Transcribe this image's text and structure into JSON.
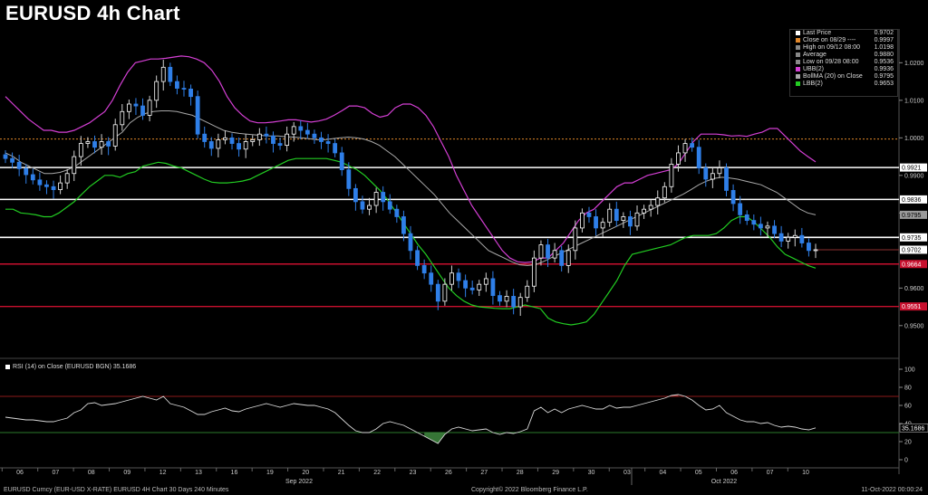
{
  "title": "EURUSD 4h Chart",
  "footer": {
    "left": "EURUSD Curncy (EUR-USD X-RATE) EURUSD 4H Chart 30 Days 240 Minutes",
    "center": "Copyright© 2022 Bloomberg Finance L.P.",
    "right": "11-Oct-2022 00:00:24"
  },
  "colors": {
    "up_candle": "#ffffff",
    "down_candle": "#2f7fe8",
    "upper_band": "#d43fd4",
    "middle_band": "#a8a8a8",
    "lower_band": "#22cc22",
    "close_ref": "#e0862a",
    "resistance": "#ffffff",
    "support": "#c8102e",
    "rsi_line": "#d8d8d8",
    "rsi_overbought": "#8b1a1a",
    "rsi_oversold": "#2d7a2d"
  },
  "legend": [
    {
      "label": "Last Price",
      "value": "0.9702",
      "color": "#ffffff"
    },
    {
      "label": "Close on 08/29 ----",
      "value": "0.9997",
      "color": "#e0862a"
    },
    {
      "label": "High on 09/12 08:00",
      "value": "1.0198",
      "color": "#888888"
    },
    {
      "label": "Average",
      "value": "0.9880",
      "color": "#888888"
    },
    {
      "label": "Low on 09/28 08:00",
      "value": "0.9536",
      "color": "#888888"
    },
    {
      "label": "UBB(2)",
      "value": "0.9936",
      "color": "#d43fd4"
    },
    {
      "label": "BollMA (20) on Close",
      "value": "0.9795",
      "color": "#a8a8a8"
    },
    {
      "label": "LBB(2)",
      "value": "0.9653",
      "color": "#22cc22"
    }
  ],
  "rsi_label": "RSI (14) on Close (EURUSD BGN) 35.1686",
  "chart_data": [
    {
      "type": "candlestick",
      "title": "EURUSD 4h Chart",
      "x_day_labels": [
        "06",
        "07",
        "08",
        "09",
        "12",
        "13",
        "16",
        "19",
        "20",
        "21",
        "22",
        "23",
        "26",
        "27",
        "28",
        "29",
        "30",
        "03",
        "04",
        "05",
        "06",
        "07",
        "10"
      ],
      "x_month_labels": [
        "Sep 2022",
        "Oct 2022"
      ],
      "ylim": [
        0.942,
        1.029
      ],
      "y_ticks": [
        "1.0200",
        "1.0100",
        "1.0000",
        "0.9900",
        "0.9800",
        "0.9600",
        "0.9500"
      ],
      "horizontal_levels": {
        "resistance": [
          "0.9921",
          "0.9836",
          "0.9735"
        ],
        "support": [
          "0.9664",
          "0.9551"
        ],
        "close_reference": "0.9997"
      },
      "right_axis_labels": [
        {
          "text": "0.9921",
          "style": "white"
        },
        {
          "text": "0.9836",
          "style": "white"
        },
        {
          "text": "0.9795",
          "style": "gray"
        },
        {
          "text": "0.9735",
          "style": "white"
        },
        {
          "text": "0.9702",
          "style": "white"
        },
        {
          "text": "0.9664",
          "style": "red"
        },
        {
          "text": "0.9551",
          "style": "red"
        }
      ],
      "close": [
        0.9945,
        0.9935,
        0.9918,
        0.9902,
        0.9888,
        0.9875,
        0.987,
        0.9862,
        0.988,
        0.9905,
        0.995,
        0.9985,
        0.999,
        0.9975,
        0.999,
        0.9978,
        1.0035,
        1.007,
        1.009,
        1.0085,
        1.006,
        1.01,
        1.015,
        1.0188,
        1.015,
        1.0132,
        1.013,
        1.011,
        1.001,
        0.999,
        0.9972,
        0.9995,
        1.0,
        0.9985,
        0.997,
        0.999,
        0.9995,
        1.001,
        1.0005,
        0.9985,
        0.998,
        1.001,
        1.003,
        1.002,
        1.001,
        1.0,
        0.999,
        0.9985,
        0.996,
        0.9915,
        0.9865,
        0.983,
        0.981,
        0.982,
        0.9855,
        0.983,
        0.981,
        0.979,
        0.9745,
        0.97,
        0.966,
        0.964,
        0.961,
        0.9565,
        0.961,
        0.964,
        0.962,
        0.96,
        0.9595,
        0.961,
        0.9625,
        0.958,
        0.9565,
        0.9578,
        0.955,
        0.9575,
        0.9605,
        0.968,
        0.9715,
        0.968,
        0.97,
        0.966,
        0.97,
        0.976,
        0.98,
        0.979,
        0.976,
        0.9775,
        0.981,
        0.978,
        0.979,
        0.9765,
        0.98,
        0.981,
        0.982,
        0.984,
        0.987,
        0.993,
        0.996,
        0.9985,
        0.9975,
        0.992,
        0.989,
        0.9905,
        0.992,
        0.986,
        0.9825,
        0.9795,
        0.978,
        0.977,
        0.976,
        0.9765,
        0.9745,
        0.9725,
        0.9735,
        0.974,
        0.972,
        0.97,
        0.9702
      ],
      "upper_band": [
        1.011,
        1.009,
        1.007,
        1.005,
        1.0035,
        1.002,
        1.002,
        1.0015,
        1.0015,
        1.002,
        1.003,
        1.004,
        1.0055,
        1.007,
        1.01,
        1.014,
        1.0175,
        1.02,
        1.0205,
        1.021,
        1.021,
        1.0212,
        1.0215,
        1.0218,
        1.0216,
        1.021,
        1.02,
        1.018,
        1.015,
        1.011,
        1.008,
        1.006,
        1.0045,
        1.004,
        1.004,
        1.0042,
        1.0045,
        1.0048,
        1.0048,
        1.0045,
        1.0042,
        1.0045,
        1.005,
        1.006,
        1.0072,
        1.0085,
        1.0085,
        1.008,
        1.0065,
        1.0055,
        1.006,
        1.008,
        1.009,
        1.009,
        1.008,
        1.006,
        1.003,
        0.999,
        0.995,
        0.99,
        0.986,
        0.982,
        0.979,
        0.976,
        0.973,
        0.97,
        0.968,
        0.967,
        0.9668,
        0.967,
        0.968,
        0.968,
        0.97,
        0.972,
        0.975,
        0.978,
        0.98,
        0.981,
        0.983,
        0.985,
        0.987,
        0.988,
        0.988,
        0.989,
        0.99,
        0.9905,
        0.991,
        0.9915,
        0.993,
        0.996,
        0.999,
        1.001,
        1.001,
        1.001,
        1.0008,
        1.0005,
        1.0006,
        1.0004,
        1.001,
        1.0015,
        1.0025,
        1.0025,
        1.0005,
        0.9985,
        0.9965,
        0.995,
        0.9936
      ],
      "middle_band": [
        0.996,
        0.995,
        0.9935,
        0.9925,
        0.9915,
        0.9905,
        0.9905,
        0.9908,
        0.9915,
        0.9925,
        0.994,
        0.9955,
        0.997,
        0.9985,
        1.0,
        1.0015,
        1.004,
        1.0055,
        1.0065,
        1.007,
        1.0072,
        1.0072,
        1.007,
        1.0065,
        1.006,
        1.005,
        1.004,
        1.003,
        1.002,
        1.0015,
        1.0012,
        1.001,
        1.0008,
        1.0006,
        1.0005,
        1.0005,
        1.0003,
        1.0002,
        1.0,
        0.9998,
        0.9995,
        0.9995,
        0.9998,
        1.0,
        1.0002,
        1.0,
        0.9997,
        0.999,
        0.998,
        0.9965,
        0.995,
        0.993,
        0.991,
        0.989,
        0.987,
        0.985,
        0.9825,
        0.98,
        0.978,
        0.976,
        0.974,
        0.972,
        0.97,
        0.969,
        0.968,
        0.967,
        0.9662,
        0.966,
        0.9662,
        0.967,
        0.968,
        0.969,
        0.97,
        0.971,
        0.972,
        0.973,
        0.974,
        0.975,
        0.976,
        0.977,
        0.978,
        0.979,
        0.98,
        0.981,
        0.982,
        0.983,
        0.984,
        0.985,
        0.9862,
        0.9875,
        0.9885,
        0.9892,
        0.9895,
        0.9893,
        0.989,
        0.9885,
        0.988,
        0.9875,
        0.9865,
        0.9855,
        0.984,
        0.9825,
        0.981,
        0.98,
        0.9795
      ],
      "lower_band": [
        0.981,
        0.981,
        0.98,
        0.9798,
        0.9795,
        0.979,
        0.979,
        0.98,
        0.9815,
        0.983,
        0.985,
        0.987,
        0.9885,
        0.99,
        0.99,
        0.9895,
        0.9905,
        0.991,
        0.9925,
        0.993,
        0.9935,
        0.9932,
        0.9925,
        0.992,
        0.991,
        0.99,
        0.989,
        0.9882,
        0.988,
        0.988,
        0.9882,
        0.9885,
        0.989,
        0.99,
        0.991,
        0.992,
        0.993,
        0.994,
        0.9945,
        0.9945,
        0.9945,
        0.9945,
        0.9945,
        0.994,
        0.9935,
        0.9925,
        0.9915,
        0.99,
        0.988,
        0.986,
        0.9835,
        0.9805,
        0.9775,
        0.9745,
        0.9715,
        0.969,
        0.966,
        0.963,
        0.96,
        0.958,
        0.9565,
        0.9555,
        0.955,
        0.9548,
        0.9546,
        0.9545,
        0.9545,
        0.955,
        0.9555,
        0.955,
        0.9545,
        0.952,
        0.951,
        0.9505,
        0.9502,
        0.9505,
        0.951,
        0.953,
        0.956,
        0.959,
        0.962,
        0.966,
        0.969,
        0.9695,
        0.97,
        0.9705,
        0.971,
        0.9715,
        0.9725,
        0.9735,
        0.974,
        0.974,
        0.974,
        0.9745,
        0.976,
        0.978,
        0.979,
        0.979,
        0.9775,
        0.9755,
        0.9735,
        0.971,
        0.969,
        0.968,
        0.967,
        0.966,
        0.9653
      ]
    },
    {
      "type": "line",
      "title": "RSI (14) on Close (EURUSD BGN)",
      "ylim": [
        -8,
        108
      ],
      "y_ticks": [
        "100",
        "80",
        "60",
        "40",
        "20",
        "0"
      ],
      "levels": {
        "overbought": 70,
        "oversold": 30
      },
      "last_value": "35.1686",
      "values": [
        47,
        46,
        45,
        44,
        44,
        43,
        42,
        42,
        44,
        46,
        52,
        55,
        62,
        63,
        60,
        61,
        62,
        64,
        66,
        68,
        70,
        68,
        66,
        70,
        62,
        60,
        58,
        54,
        50,
        50,
        53,
        55,
        57,
        54,
        53,
        56,
        58,
        60,
        62,
        60,
        58,
        60,
        62,
        61,
        60,
        60,
        58,
        56,
        52,
        45,
        38,
        32,
        30,
        30,
        34,
        40,
        42,
        40,
        38,
        34,
        30,
        26,
        22,
        18,
        28,
        34,
        36,
        34,
        32,
        33,
        34,
        30,
        28,
        30,
        29,
        31,
        34,
        54,
        58,
        52,
        56,
        52,
        56,
        58,
        60,
        58,
        56,
        56,
        60,
        57,
        58,
        58,
        60,
        62,
        64,
        66,
        68,
        71,
        72,
        70,
        66,
        60,
        55,
        56,
        60,
        52,
        48,
        44,
        42,
        42,
        40,
        41,
        38,
        36,
        37,
        36,
        34,
        33,
        35.17
      ]
    }
  ]
}
